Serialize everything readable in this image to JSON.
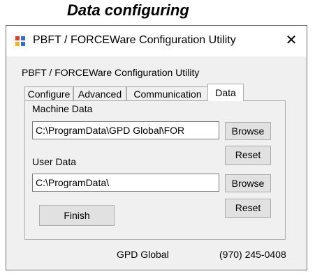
{
  "caption": "Data configuring",
  "window": {
    "title": "PBFT / FORCEWare Configuration Utility",
    "close_glyph": "✕",
    "icon": "app-window-icon"
  },
  "app_label": "PBFT / FORCEWare Configuration Utility",
  "tabs": [
    {
      "label": "Configure",
      "active": false
    },
    {
      "label": "Advanced",
      "active": false
    },
    {
      "label": "Communication",
      "active": false
    },
    {
      "label": "Data",
      "active": true
    }
  ],
  "machine_data": {
    "label": "Machine Data",
    "value": "C:\\ProgramData\\GPD Global\\FOR",
    "browse_label": "Browse",
    "reset_label": "Reset"
  },
  "user_data": {
    "label": "User Data",
    "value": "C:\\ProgramData\\",
    "browse_label": "Browse",
    "reset_label": "Reset"
  },
  "finish_label": "Finish",
  "status": {
    "company": "GPD Global",
    "phone": "(970) 245-0408"
  }
}
